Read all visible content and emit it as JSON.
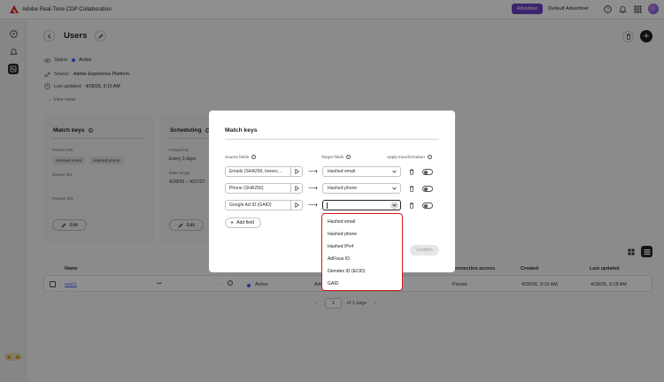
{
  "app": {
    "title": "Adobe Real-Time CDP Collaboration",
    "role_badge": "Advertiser",
    "account_name": "Default Advertiser"
  },
  "topbar_icons": [
    "help-icon",
    "bell-icon",
    "apps-grid-icon",
    "user-avatar"
  ],
  "leftnav": {
    "items": [
      {
        "icon": "compass-icon",
        "active": false
      },
      {
        "icon": "bell-icon",
        "active": false
      },
      {
        "icon": "collaboration-icon",
        "active": true
      }
    ],
    "expand_label": "»"
  },
  "page": {
    "title": "Users",
    "status_label": "Status:",
    "status_value": "Active",
    "source_label": "Source:",
    "source_value": "Adobe Experience Platform",
    "updated_label": "Last updated:",
    "updated_value": "4/28/26, 9:16 AM",
    "view_more": "View more"
  },
  "cards": {
    "match_keys": {
      "title": "Match keys",
      "person_ids_label": "Person IDs",
      "person_ids": [
        "Hashed email",
        "Hashed phone"
      ],
      "device_ids_label": "Device IDs",
      "device_ids_value": "-",
      "partner_ids_label": "Partner IDs",
      "edit_label": "Edit"
    },
    "scheduling": {
      "title": "Scheduling",
      "frequency_label": "Frequency",
      "frequency_value": "Every 3 days",
      "date_range_label": "Date range",
      "date_range_value": "4/28/26 – 4/27/27",
      "edit_label": "Edit"
    }
  },
  "table": {
    "headers": [
      "Name",
      "Connection access",
      "Created",
      "Last updated"
    ],
    "rows": [
      {
        "name": "user1",
        "more": "•••",
        "dash": "-",
        "status": "Active",
        "partial": "Adv",
        "access": "Private",
        "created": "4/28/26, 9:16 AM",
        "updated": "4/28/26, 9:18 AM"
      }
    ]
  },
  "pagination": {
    "prev": "‹",
    "page": "1",
    "of_label": "of 1 page",
    "next": "›"
  },
  "modal": {
    "title": "Match keys",
    "col_source": "Source fields",
    "col_target": "Target fields",
    "col_transform": "Apply transformation",
    "mappings": [
      {
        "source": "Emails (SHA256, lowerc...",
        "target": "Hashed email"
      },
      {
        "source": "Phone (SHA256)",
        "target": "Hashed phone"
      },
      {
        "source": "Google Ad ID (GAID)",
        "target": ""
      }
    ],
    "arrow": "⟶",
    "add_field": "Add field",
    "confirm": "Confirm",
    "dropdown_options": [
      "Hashed email",
      "Hashed phone",
      "Hashed IPv4",
      "AdFixus ID",
      "Demdex ID (ECID)",
      "GAID"
    ]
  },
  "colors": {
    "accent_purple": "#6e43c4",
    "status_blue": "#3b63fb",
    "highlight_red": "#d21d1d"
  }
}
